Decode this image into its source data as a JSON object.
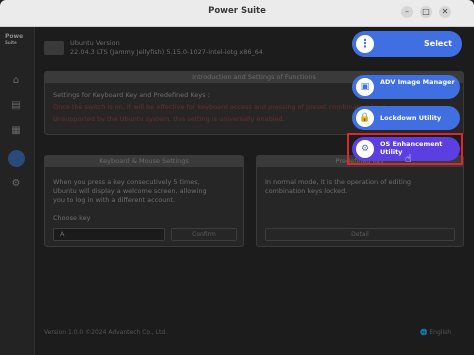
{
  "window": {
    "title": "Power Suite",
    "minimize": "–",
    "maximize": "□",
    "close": "✕"
  },
  "sidebar": {
    "logo_line1": "Powe",
    "logo_line2": "Suite"
  },
  "system": {
    "line1": "Ubuntu Version",
    "line2": "22.04.3 LTS (Jammy Jellyfish) 5.15.0-1027-intel-iotg x86_64"
  },
  "panel_top": {
    "header": "Introduction and Settings of Functions",
    "line1": "Settings for Keyboard Key and Predefined Keys :",
    "line2": "Once the switch is on, it will be effective for keyboard access and pressing of preset combination keys.",
    "line3": "Unsupported by the Ubuntu system, this setting is universally enabled."
  },
  "panel_left": {
    "header": "Keyboard & Mouse Settings",
    "desc1": "When you press a key consecutively 5 times,",
    "desc2": "Ubuntu will display a welcome screen, allowing",
    "desc3": "you to log in with a different account.",
    "field_label": "Choose key",
    "field_value": "A",
    "confirm_label": "Confirm"
  },
  "panel_right": {
    "header": "Predefined Key",
    "desc1": "In normal mode, it is the operation of editing",
    "desc2": "combination keys locked.",
    "button_label": "Detail"
  },
  "footer": {
    "left": "Version 1.0.0 ©2024 Advantech Co., Ltd.",
    "right": "English"
  },
  "menu": {
    "select_label": "Select",
    "items": [
      {
        "label": "ADV Image Manager",
        "icon": "image-icon"
      },
      {
        "label": "Lockdown Utility",
        "icon": "lock-icon"
      },
      {
        "label": "OS Enhancement Utility",
        "icon": "os-enhancement-icon"
      }
    ]
  },
  "colors": {
    "accent": "#3f6fe0",
    "highlight": "#5b3fe0",
    "focus_border": "#e0262b"
  }
}
